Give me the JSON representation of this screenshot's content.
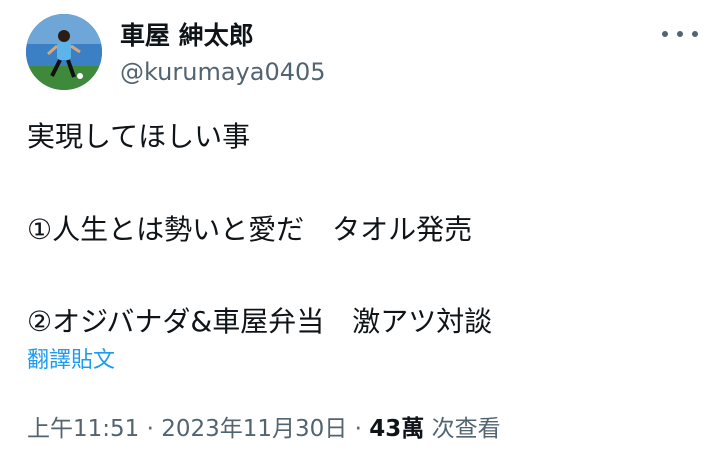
{
  "author": {
    "display_name": "車屋 紳太郎",
    "handle": "@kurumaya0405",
    "avatar_icon": "player-avatar-icon"
  },
  "tweet": {
    "lines": [
      "実現してほしい事",
      "①人生とは勢いと愛だ　タオル発売",
      "②オジバナダ&車屋弁当　激アツ対談"
    ],
    "translate_label": "翻譯貼文"
  },
  "meta": {
    "time": "上午11:51",
    "sep1": " · ",
    "date": "2023年11月30日",
    "sep2": " · ",
    "views_count": "43萬",
    "views_label": " 次查看"
  },
  "colors": {
    "text": "#0f1419",
    "secondary": "#536471",
    "link": "#1d9bf0"
  },
  "icons": {
    "more": "more-dots-icon"
  }
}
